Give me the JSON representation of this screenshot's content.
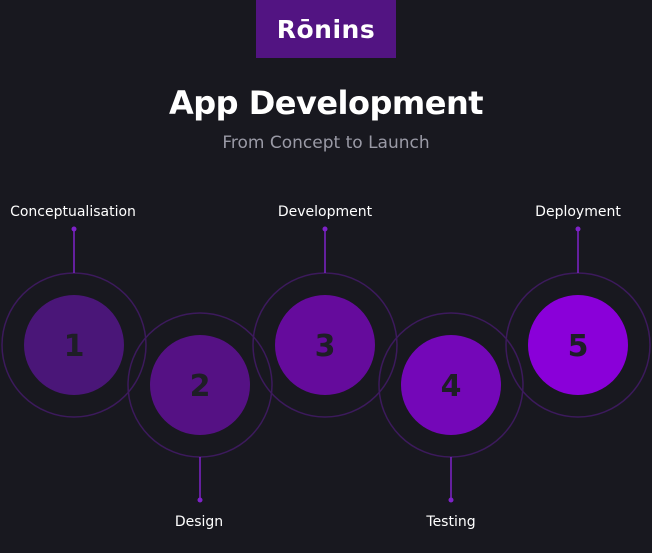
{
  "brand": {
    "logo_text": "Rōnins"
  },
  "header": {
    "title": "App Development",
    "subtitle": "From Concept to Launch"
  },
  "steps": [
    {
      "number": "1",
      "label": "Conceptualisation",
      "color": "#4a1678"
    },
    {
      "number": "2",
      "label": "Design",
      "color": "#551184"
    },
    {
      "number": "3",
      "label": "Development",
      "color": "#650b9c"
    },
    {
      "number": "4",
      "label": "Testing",
      "color": "#7407b8"
    },
    {
      "number": "5",
      "label": "Deployment",
      "color": "#8a00d9"
    }
  ],
  "colors": {
    "background": "#18181f",
    "ring": "#3c1a5c",
    "connector": "#7e22c8"
  }
}
